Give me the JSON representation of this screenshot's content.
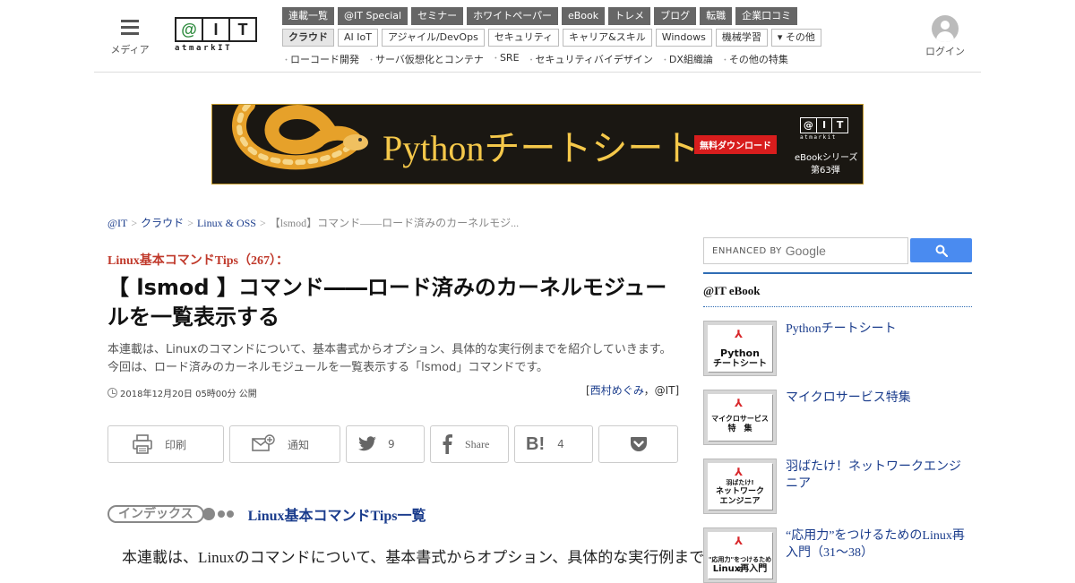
{
  "header": {
    "menu_label": "メディア",
    "logo": {
      "at": "@",
      "i": "I",
      "t": "T",
      "sub": "atmarkIT"
    },
    "nav_primary": [
      "連載一覧",
      "@IT Special",
      "セミナー",
      "ホワイトペーパー",
      "eBook",
      "トレメ",
      "ブログ",
      "転職",
      "企業口コミ"
    ],
    "nav_secondary": [
      "クラウド",
      "AI IoT",
      "アジャイル/DevOps",
      "セキュリティ",
      "キャリア&スキル",
      "Windows",
      "機械学習",
      "▾ その他"
    ],
    "nav_secondary_active": "クラウド",
    "nav_tertiary": [
      "ローコード開発",
      "サーバ仮想化とコンテナ",
      "SRE",
      "セキュリティバイデザイン",
      "DX組織論",
      "その他の特集"
    ],
    "login_label": "ログイン"
  },
  "banner": {
    "title": "Pythonチートシート",
    "cta": "無料ダウンロード",
    "brand": {
      "at": "@",
      "i": "I",
      "t": "T",
      "sub": "atmarkit"
    },
    "series": "eBookシリーズ",
    "volume": "第63弾"
  },
  "breadcrumb": [
    "@IT",
    "クラウド",
    "Linux & OSS"
  ],
  "breadcrumb_sep": ">",
  "breadcrumb_current": "【lsmod】コマンド――ロード済みのカーネルモジ...",
  "article": {
    "series": "Linux基本コマンドTips（267）：",
    "title": "【 lsmod 】コマンド――ロード済みのカーネルモジュールを一覧表示する",
    "lead_1": "本連載は、Linuxのコマンドについて、基本書式からオプション、具体的な実行例までを紹介していきます。",
    "lead_2": "今回は、ロード済みのカーネルモジュールを一覧表示する「lsmod」コマンドです。",
    "date": "2018年12月20日 05時00分 公開",
    "author_open": "[",
    "author_name": "西村めぐみ",
    "author_sep": "，",
    "author_org": "@IT",
    "author_close": "]"
  },
  "share": {
    "print": "印刷",
    "notify": "通知",
    "twitter_count": "9",
    "facebook": "Share",
    "hatena_count": "4"
  },
  "index": {
    "badge": "インデックス",
    "link": "Linux基本コマンドTips一覧"
  },
  "body_text": "本連載は、Linuxのコマンドについて、基本書式からオプション、具体的な実行例まで",
  "sidebar": {
    "search_enhanced": "ENHANCED BY",
    "search_google": "Google",
    "ebook_heading": "@IT eBook",
    "ebooks": [
      {
        "title": "Pythonチートシート",
        "thumb_line1": "Python",
        "thumb_line2": "チートシート"
      },
      {
        "title": "マイクロサービス特集",
        "thumb_line1": "マイクロサービス",
        "thumb_line2": "特　集"
      },
      {
        "title": "羽ばたけ！ネットワークエンジニア",
        "thumb_line0": "羽ばたけ!",
        "thumb_line1": "ネットワーク",
        "thumb_line2": "エンジニア"
      },
      {
        "title": "“応用力”をつけるためのLinux再入門（31～38）",
        "thumb_line1": "\"応用力\"をつけるための",
        "thumb_line2": "Linux再入門"
      }
    ]
  }
}
